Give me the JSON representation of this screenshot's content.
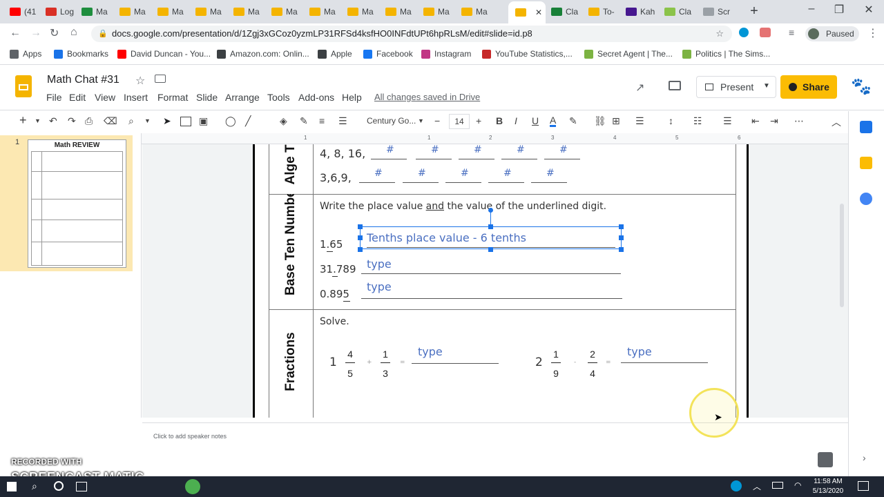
{
  "browser": {
    "tabs": [
      {
        "label": "(41",
        "color": "#ff0000"
      },
      {
        "label": "Log",
        "color": "#d93025"
      },
      {
        "label": "Ma",
        "color": "#1e8e3e"
      },
      {
        "label": "Ma",
        "color": "#f4b400"
      },
      {
        "label": "Ma",
        "color": "#f4b400"
      },
      {
        "label": "Ma",
        "color": "#f4b400"
      },
      {
        "label": "Ma",
        "color": "#f4b400"
      },
      {
        "label": "Ma",
        "color": "#f4b400"
      },
      {
        "label": "Ma",
        "color": "#f4b400"
      },
      {
        "label": "Ma",
        "color": "#f4b400"
      },
      {
        "label": "Ma",
        "color": "#f4b400"
      },
      {
        "label": "Ma",
        "color": "#f4b400"
      },
      {
        "label": "Ma",
        "color": "#f4b400"
      },
      {
        "label": "",
        "color": "#f4b400"
      },
      {
        "label": "Cla",
        "color": "#188038"
      },
      {
        "label": "To-",
        "color": "#f4b400"
      },
      {
        "label": "Kah",
        "color": "#46178f"
      },
      {
        "label": "Cla",
        "color": "#8bc34a"
      },
      {
        "label": "Scr",
        "color": "#9aa0a6"
      }
    ],
    "url": "docs.google.com/presentation/d/1Zgj3xGCoz0yzmLP31RFSd4ksfHO0INFdtUPt6hpRLsM/edit#slide=id.p8",
    "profile_status": "Paused",
    "bookmarks": [
      {
        "label": "Apps",
        "color": "#5f6368"
      },
      {
        "label": "Bookmarks",
        "color": "#1a73e8"
      },
      {
        "label": "David Duncan - You...",
        "color": "#ff0000"
      },
      {
        "label": "Amazon.com: Onlin...",
        "color": "#3c4043"
      },
      {
        "label": "Apple",
        "color": "#3c4043"
      },
      {
        "label": "Facebook",
        "color": "#1877f2"
      },
      {
        "label": "Instagram",
        "color": "#c13584"
      },
      {
        "label": "YouTube Statistics,...",
        "color": "#c62828"
      },
      {
        "label": "Secret Agent | The...",
        "color": "#7cb342"
      },
      {
        "label": "Politics | The Sims...",
        "color": "#7cb342"
      }
    ]
  },
  "slides": {
    "title": "Math Chat #31",
    "menu": [
      "File",
      "Edit",
      "View",
      "Insert",
      "Format",
      "Slide",
      "Arrange",
      "Tools",
      "Add-ons",
      "Help"
    ],
    "saved_status": "All changes saved in Drive",
    "present_label": "Present",
    "share_label": "Share",
    "font_name": "Century Go...",
    "font_size": "14",
    "ruler_ticks": [
      "1",
      "1",
      "2",
      "3",
      "4",
      "5",
      "6"
    ],
    "slide_number": "1",
    "thumb_title": "Math REVIEW",
    "notes_placeholder": "Click to add speaker notes"
  },
  "slide_content": {
    "algebraic_label": "Alge Thi",
    "seq1": "4, 8, 16,",
    "seq2": "3,6,9,",
    "hash": "#",
    "base_ten_label": "Base Ten Numbers",
    "place_value_prompt": "Write the place value and the value of the underlined digit.",
    "prompt_underlined": "and",
    "num1": "1.65",
    "num2": "31.789",
    "num3": "0.895",
    "answer1": "Tenths place value - 6 tenths",
    "type": "type",
    "fractions_label": "Fractions",
    "solve": "Solve.",
    "frac1_whole": "1",
    "frac1_num": "4",
    "frac1_den": "5",
    "frac1_op": "+",
    "frac2_num": "1",
    "frac2_den": "3",
    "eq": "=",
    "frac3_whole": "2",
    "frac3_num": "1",
    "frac3_den": "9",
    "frac3_op": "-",
    "frac4_num": "2",
    "frac4_den": "4"
  },
  "taskbar": {
    "time": "11:58 AM",
    "date": "5/13/2020"
  },
  "watermark": {
    "line1": "RECORDED WITH",
    "line2": "SCREENCAST MATIC"
  }
}
